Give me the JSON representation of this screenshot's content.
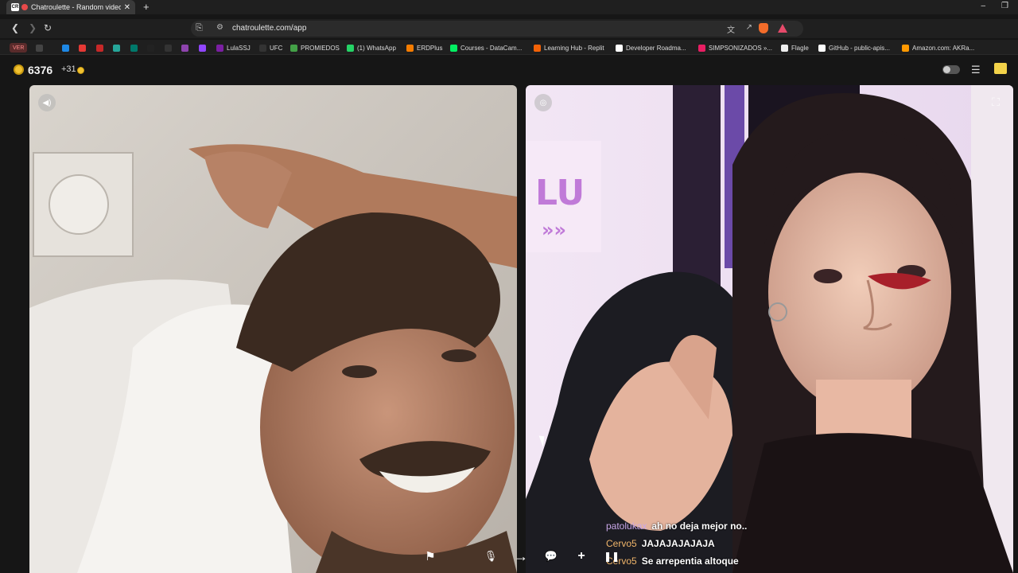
{
  "browser": {
    "tab_title": "Chatroulette - Random video",
    "tab_favicon": "CR",
    "new_tab_label": "+",
    "window_controls": [
      "–",
      "❐"
    ],
    "url": "chatroulette.com/app"
  },
  "bookmarks": [
    {
      "label": "VER",
      "color": "#c24141"
    },
    {
      "label": "",
      "icon": "apps-grid-icon",
      "color": "#444444"
    },
    {
      "label": "",
      "icon": "blue-app-icon",
      "color": "#1e88e5"
    },
    {
      "label": "",
      "icon": "youtube-icon",
      "color": "#e53935"
    },
    {
      "label": "",
      "icon": "red-app-icon",
      "color": "#c62828"
    },
    {
      "label": "",
      "icon": "green-circle-icon",
      "color": "#26a69a"
    },
    {
      "label": "",
      "icon": "teal-app-icon",
      "color": "#00796b"
    },
    {
      "label": "",
      "icon": "x-icon",
      "color": "#222222"
    },
    {
      "label": "",
      "icon": "threads-icon",
      "color": "#333333"
    },
    {
      "label": "",
      "icon": "colorful-app-icon",
      "color": "#8e44ad"
    },
    {
      "label": "",
      "icon": "twitch-icon",
      "color": "#9146ff"
    },
    {
      "label": "LulaSSJ",
      "color": "#7b1fa2"
    },
    {
      "label": "UFC",
      "color": "#333333"
    },
    {
      "label": "PROMIEDOS",
      "color": "#43a047"
    },
    {
      "label": "(1) WhatsApp",
      "color": "#25d366"
    },
    {
      "label": "ERDPlus",
      "color": "#f57c00"
    },
    {
      "label": "Courses - DataCam...",
      "color": "#03ef62"
    },
    {
      "label": "Learning Hub - Replit",
      "color": "#f26207"
    },
    {
      "label": "Developer Roadma...",
      "color": "#ffffff"
    },
    {
      "label": "SIMPSONIZADOS »...",
      "color": "#e91e63"
    },
    {
      "label": "Flagle",
      "color": "#eeeeee"
    },
    {
      "label": "GitHub - public-apis...",
      "color": "#ffffff"
    },
    {
      "label": "Amazon.com: AKRa...",
      "color": "#ff9900"
    }
  ],
  "app": {
    "coins": "6376",
    "coin_bonus": "+31",
    "coin_color": "#f1c232",
    "chat_icon_color": "#f2d249"
  },
  "chat": [
    {
      "user": "patolukax",
      "text": "ah no deja mejor no..",
      "user_color": "#c8a6e8"
    },
    {
      "user": "Cervo5",
      "text": "JAJAJAJAJAJA",
      "user_color": "#f0b56a"
    },
    {
      "user": "Cervo5",
      "text": "Se arrepentia altoque",
      "user_color": "#f0b56a"
    }
  ],
  "controls": [
    {
      "name": "report-flag-icon",
      "glyph": "⚑"
    },
    {
      "name": "microphone-icon",
      "glyph": "🎙"
    },
    {
      "name": "next-arrow-icon",
      "glyph": "→"
    },
    {
      "name": "chat-bubble-icon",
      "glyph": "💬"
    },
    {
      "name": "add-friend-icon",
      "glyph": "+"
    },
    {
      "name": "pause-icon",
      "glyph": "❚❚"
    }
  ]
}
